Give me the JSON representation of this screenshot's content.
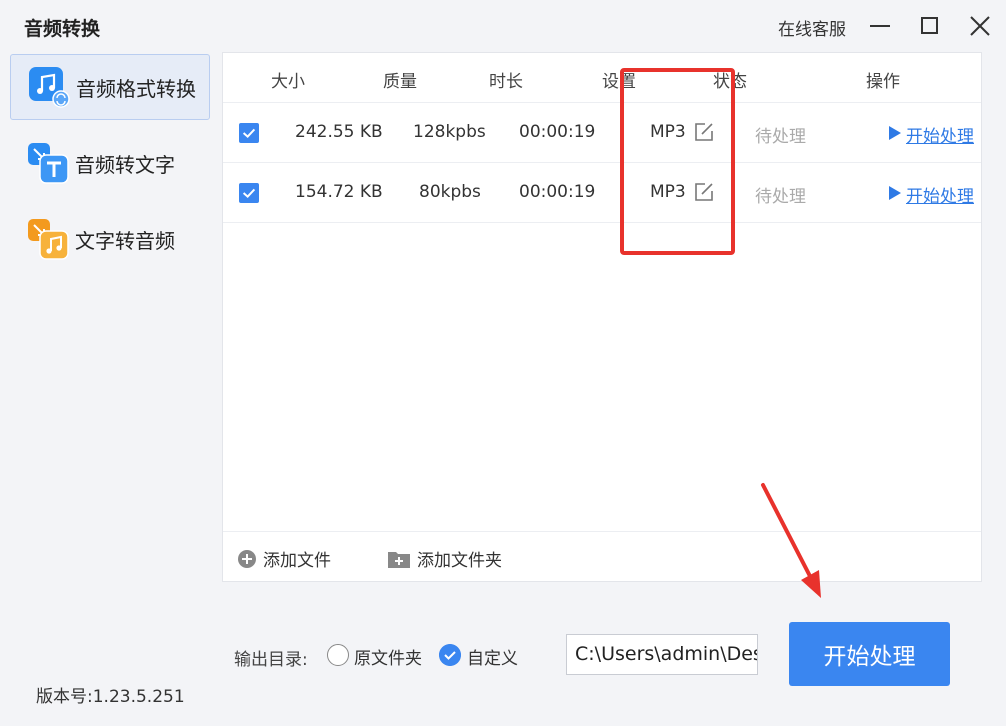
{
  "app": {
    "title": "音频转换"
  },
  "titlebar": {
    "support_label": "在线客服"
  },
  "sidebar": {
    "items": [
      {
        "label": "音频格式转换",
        "icon": "music-convert-icon",
        "active": true
      },
      {
        "label": "音频转文字",
        "icon": "audio-to-text-icon",
        "active": false
      },
      {
        "label": "文字转音频",
        "icon": "text-to-audio-icon",
        "active": false
      }
    ],
    "version": "版本号:1.23.5.251"
  },
  "table": {
    "columns": [
      "大小",
      "质量",
      "时长",
      "设置",
      "状态",
      "操作"
    ],
    "rows": [
      {
        "checked": true,
        "size": "242.55 KB",
        "quality": "128kpbs",
        "duration": "00:00:19",
        "format": "MP3",
        "status": "待处理",
        "action": "开始处理"
      },
      {
        "checked": true,
        "size": "154.72 KB",
        "quality": "80kpbs",
        "duration": "00:00:19",
        "format": "MP3",
        "status": "待处理",
        "action": "开始处理"
      }
    ]
  },
  "footer": {
    "add_file": "添加文件",
    "add_folder": "添加文件夹"
  },
  "output": {
    "label": "输出目录:",
    "option_original": "原文件夹",
    "option_custom": "自定义",
    "selected": "自定义",
    "path": "C:\\Users\\admin\\Desktop"
  },
  "start_button": "开始处理",
  "colors": {
    "accent": "#3a86f0",
    "highlight": "#e8322c",
    "link": "#2f7ae5"
  }
}
